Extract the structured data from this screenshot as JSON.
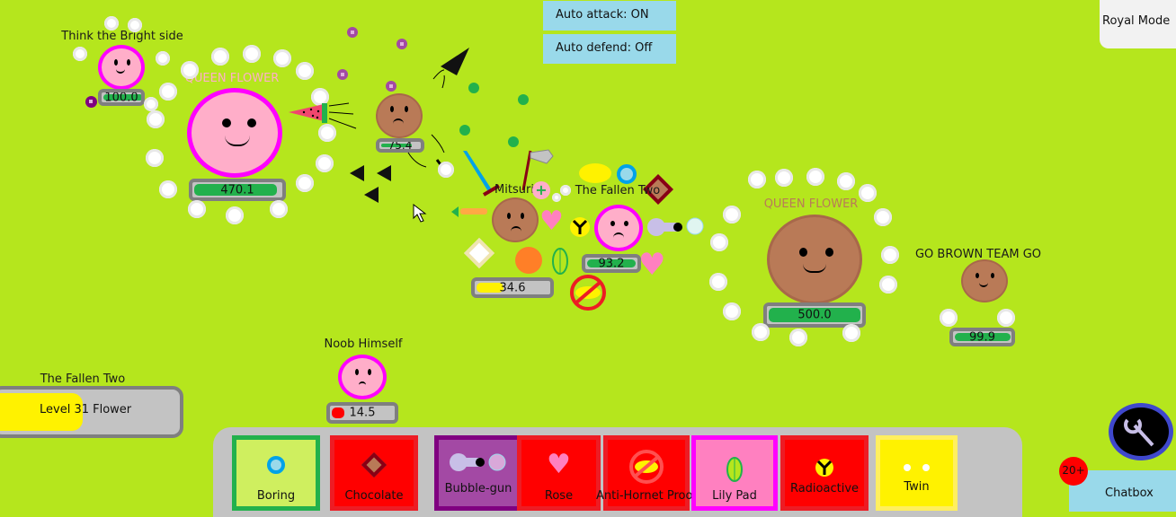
{
  "game_mode": "Royal Mode",
  "toggles": {
    "auto_attack": "Auto attack: ON",
    "auto_defend": "Auto defend: Off"
  },
  "players": [
    {
      "name": "Think the Bright side",
      "health": "100.0",
      "health_fraction": 1.0,
      "color": "#ffaec9",
      "mood": "happy"
    },
    {
      "name": "QUEEN FLOWER",
      "health": "470.1",
      "health_fraction": 0.94,
      "color": "#ffaec9",
      "mood": "happy",
      "name_color": "#ffaec9"
    },
    {
      "name": "",
      "health": "75.4",
      "health_fraction": 0.75,
      "color": "#b97a57",
      "mood": "angry"
    },
    {
      "name": "Mitsuri",
      "health": "34.6",
      "health_fraction": 0.35,
      "color": "#b97a57",
      "mood": "sad",
      "bar_color": "#fff200"
    },
    {
      "name": "The Fallen Two",
      "health": "93.2",
      "health_fraction": 0.93,
      "color": "#ffaec9",
      "mood": "angry"
    },
    {
      "name": "QUEEN FLOWER",
      "health": "500.0",
      "health_fraction": 1.0,
      "color": "#b97a57",
      "mood": "happy",
      "name_color": "#b97a57"
    },
    {
      "name": "GO BROWN TEAM GO",
      "health": "99.9",
      "health_fraction": 1.0,
      "color": "#b97a57",
      "mood": "happy"
    },
    {
      "name": "Noob Himself",
      "health": "14.5",
      "health_fraction": 0.15,
      "color": "#ffaec9",
      "mood": "sad",
      "bar_color": "#ff0000"
    }
  ],
  "level_panel": {
    "player_name": "The Fallen Two",
    "level_text": "Level 31 Flower",
    "xp_fraction": 0.42
  },
  "hotbar": [
    {
      "label": "Boring",
      "icon": "boring-petal-icon",
      "bg": "#cfef5f",
      "border": "#22b14c"
    },
    {
      "label": "Chocolate",
      "icon": "chocolate-petal-icon",
      "bg": "#ff0000",
      "border": "#ed1c24"
    },
    {
      "label": "Bubble-gun",
      "icon": "bubble-gun-petal-icon",
      "bg": "#a349a4",
      "border": "#800080"
    },
    {
      "label": "Rose",
      "icon": "rose-petal-icon",
      "bg": "#ff0000",
      "border": "#ed1c24"
    },
    {
      "label": "Anti-Hornet Proof",
      "icon": "anti-hornet-petal-icon",
      "bg": "#ff0000",
      "border": "#ed1c24"
    },
    {
      "label": "Lily Pad",
      "icon": "lily-pad-petal-icon",
      "bg": "#ff80c0",
      "border": "#ff00ff"
    },
    {
      "label": "Radioactive",
      "icon": "radioactive-petal-icon",
      "bg": "#ff0000",
      "border": "#ed1c24"
    },
    {
      "label": "Twin",
      "icon": "twin-petal-icon",
      "bg": "#fff200",
      "border": "#ffef5f"
    }
  ],
  "chat": {
    "label": "Chatbox",
    "unread_badge": "20+"
  },
  "settings_icon": "wrench-icon"
}
